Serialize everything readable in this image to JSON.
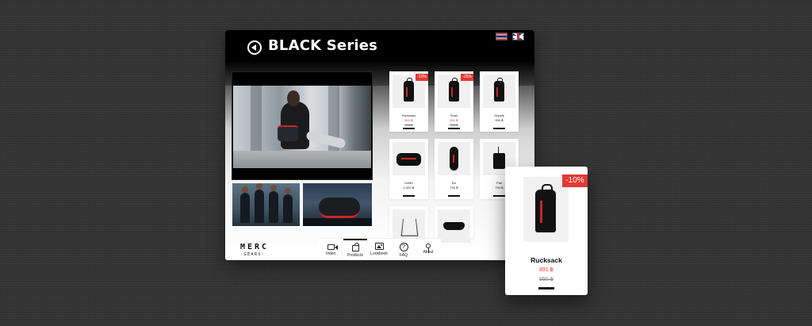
{
  "header": {
    "title": "BLACK Series",
    "back_icon": "back-arrow-icon",
    "languages": [
      "Thai",
      "English"
    ]
  },
  "logo": {
    "line1": "MERC",
    "line2": "·GEARS·"
  },
  "products": [
    {
      "name": "Rucksack",
      "price": "891 ฿",
      "old_price": "990 ฿",
      "discount": "-10%"
    },
    {
      "name": "Suan",
      "price": "891 ฿",
      "old_price": "990 ฿",
      "discount": "-25%"
    },
    {
      "name": "Gripple",
      "price": "990 ฿",
      "old_price": "",
      "discount": ""
    },
    {
      "name": "Duffel",
      "price": "1,490 ฿",
      "old_price": "",
      "discount": ""
    },
    {
      "name": "Bu",
      "price": "790 ฿",
      "old_price": "",
      "discount": ""
    },
    {
      "name": "Pati",
      "price": "790 ฿",
      "old_price": "",
      "discount": ""
    },
    {
      "name": "",
      "price": "",
      "old_price": "",
      "discount": ""
    },
    {
      "name": "",
      "price": "",
      "old_price": "",
      "discount": ""
    }
  ],
  "nav": {
    "active": "Products",
    "items": [
      {
        "label": "Video",
        "icon": "video-icon"
      },
      {
        "label": "Products",
        "icon": "bag-icon"
      },
      {
        "label": "Lookbook",
        "icon": "image-icon"
      },
      {
        "label": "FAQ",
        "icon": "question-icon"
      },
      {
        "label": "About",
        "icon": "location-pin-icon"
      }
    ]
  },
  "featured": {
    "name": "Rucksack",
    "price": "891 ฿",
    "old_price": "990 ฿",
    "discount": "-10%"
  },
  "colors": {
    "accent": "#e53935",
    "header": "#000000",
    "background": "#343434"
  }
}
